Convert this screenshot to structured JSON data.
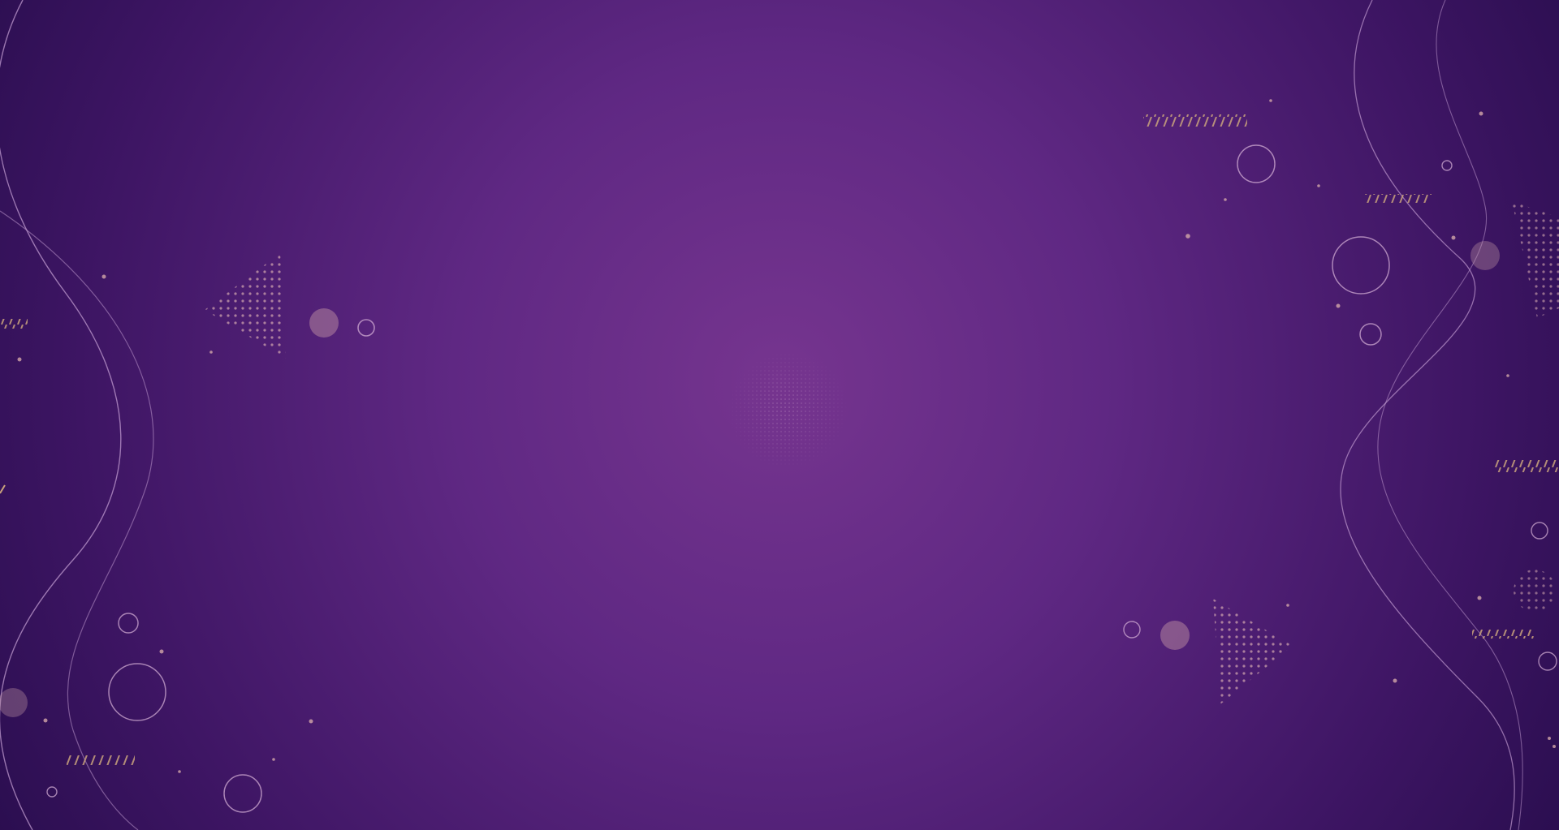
{
  "scene": {
    "description_tag": "decorative-background",
    "colors": {
      "center": "#76358f",
      "mid": "#5a2680",
      "edge": "#2a0e4f",
      "line": "#c9a6d9",
      "accent_gold": "#c9a27c",
      "accent_pink": "#c79aa6",
      "dot": "#d3a7a9"
    }
  }
}
